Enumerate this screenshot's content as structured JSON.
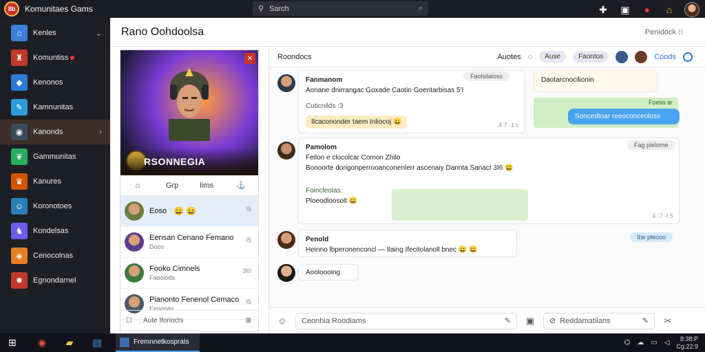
{
  "app": {
    "title": "Komunitaes Gams",
    "logo_text": "8b"
  },
  "search": {
    "placeholder": "Sarch"
  },
  "sidebar": {
    "items": [
      {
        "label": "Kenles",
        "icon": "home-icon",
        "color": "#3a82d6",
        "glyph": "⌂",
        "chevron": "⌄"
      },
      {
        "label": "Komuntiss",
        "icon": "community-icon",
        "color": "#c0392b",
        "glyph": "♜",
        "badge": true
      },
      {
        "label": "Kenonos",
        "icon": "game-icon",
        "color": "#2b7bd6",
        "glyph": "◆"
      },
      {
        "label": "Kamnunitas",
        "icon": "chat-icon",
        "color": "#2d9cdb",
        "glyph": "✎"
      },
      {
        "label": "Kanonds",
        "icon": "controller-icon",
        "color": "#394a5a",
        "glyph": "◉",
        "active": true,
        "chevron": "›"
      },
      {
        "label": "Gammunitas",
        "icon": "leaf-icon",
        "color": "#27ae60",
        "glyph": "❦"
      },
      {
        "label": "Kanures",
        "icon": "trophy-icon",
        "color": "#d35400",
        "glyph": "♛"
      },
      {
        "label": "Koronotoes",
        "icon": "character-icon",
        "color": "#2980b9",
        "glyph": "☺"
      },
      {
        "label": "Kondelsas",
        "icon": "knight-icon",
        "color": "#6c5ce7",
        "glyph": "♞"
      },
      {
        "label": "Cenocolnas",
        "icon": "gem-icon",
        "color": "#e67e22",
        "glyph": "◈"
      },
      {
        "label": "Egnondarnel",
        "icon": "fire-icon",
        "color": "#c0392b",
        "glyph": "✹"
      }
    ]
  },
  "main": {
    "title": "Rano Oohdoolsa",
    "header_right": "Penidock  ⁝⁝"
  },
  "card": {
    "hero_title": "RSONNEGIA",
    "tabs": [
      "Grp",
      "Iims"
    ],
    "friends": [
      {
        "name": "Eoso",
        "sub": "",
        "num": "I5",
        "emoji": "😀 😀",
        "active": true,
        "av": "#6b7a3d"
      },
      {
        "name": "Eensan Cenano Femano",
        "sub": "Doos",
        "num": "I5",
        "emoji": "",
        "av": "#5b3d8a"
      },
      {
        "name": "Fooko Cimnels",
        "sub": "Faooiods",
        "num": "3I0",
        "emoji": "",
        "av": "#3d7a3d"
      },
      {
        "name": "Pianonto Fenenol Cemaco",
        "sub": "Eenonas",
        "num": "I5",
        "emoji": "",
        "av": "#4a5a6a"
      }
    ],
    "footer": "Aute Iforiocts"
  },
  "chat": {
    "header": {
      "title": "Roondocs",
      "actions_label": "Auotes",
      "pill_label": "Ause",
      "pill2_label": "Faontos",
      "codes_label": "Coods"
    },
    "messages": [
      {
        "name": "Fanmanom",
        "text": "Aonane dnirrangac Goxade Caotin Goentarbisas 5'I",
        "sub": "Cuticnilds :3",
        "highlight": "Ilcacononder taem Inliocoj 😀",
        "time": "4 7 ·1 c"
      },
      {
        "name": "Pamolom",
        "text": "Feilon e clocolcar Comon  Zhilo",
        "text2": "Bonoorte dorigonperrooanconenlerr ascenaiy Dannta Sanact  3I6 😀",
        "sub": "Foincleolas:",
        "highlight": "Ploeodloosolt 😀",
        "time": "4 ·7 ·I 5"
      },
      {
        "name": "Penold",
        "text": "Heinno lbperonenconcl  — Ilaing Ifecitolanoll bnec 😀 😀"
      },
      {
        "name": "Aooloooing"
      }
    ],
    "right_msgs": [
      {
        "text": "Daotarcnocilionin"
      },
      {
        "text": "Foeiia ar"
      },
      {
        "text": "Soncedtoar reeoconceoloss"
      }
    ],
    "tags": [
      "Faolsilaloss",
      "Fag plelome",
      "Ibe pleooo"
    ],
    "composer": {
      "placeholder": "Ceonhia Roodiams",
      "placeholder2": "Reddamatilans"
    }
  },
  "taskbar": {
    "app_label": "Fremnnetkosprats",
    "clock_time": "8:38:P",
    "clock_date": "Cg:22:9"
  }
}
